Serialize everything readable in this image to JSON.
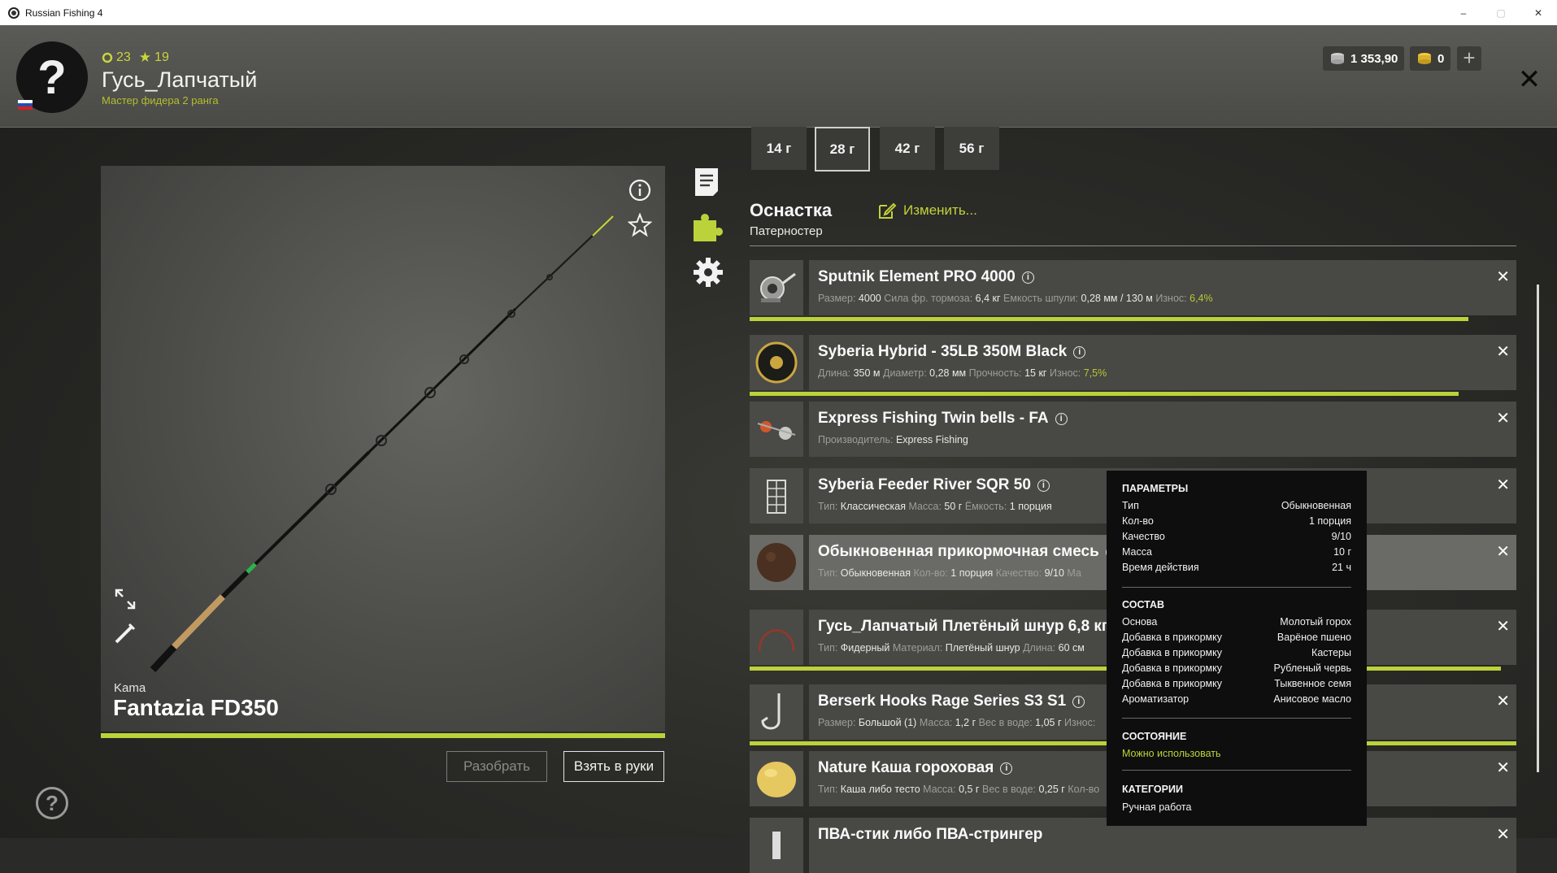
{
  "window": {
    "title": "Russian Fishing 4",
    "min": "–",
    "max": "▢",
    "close": "✕"
  },
  "player": {
    "avatar_glyph": "?",
    "level": "23",
    "stars": "19",
    "name": "Гусь_Лапчатый",
    "rank": "Мастер фидера 2 ранга"
  },
  "currency": {
    "silver": "1 353,90",
    "gold": "0",
    "plus": "+"
  },
  "rod": {
    "brand": "Kama",
    "name": "Fantazia FD350",
    "progress": 1.0,
    "btn_disassemble": "Разобрать",
    "btn_take": "Взять в руки"
  },
  "weights": [
    "14 г",
    "28 г",
    "42 г",
    "56 г"
  ],
  "weights_active": "28 г",
  "tackle": {
    "title": "Оснастка",
    "subtitle": "Патерностер",
    "change": "Изменить..."
  },
  "items": [
    {
      "name": "Sputnik Element PRO 4000",
      "info": true,
      "details": [
        [
          "Размер:",
          "4000"
        ],
        [
          "Сила фр. тормоза:",
          "6,4 кг"
        ],
        [
          "Емкость шпули:",
          "0,28 мм / 130 м"
        ],
        [
          "Износ:",
          "6,4%"
        ]
      ],
      "durability": 0.937
    },
    {
      "name": "Syberia Hybrid - 35LB 350M Black",
      "info": true,
      "details": [
        [
          "Длина:",
          "350 м"
        ],
        [
          "Диаметр:",
          "0,28 мм"
        ],
        [
          "Прочность:",
          "15 кг"
        ],
        [
          "Износ:",
          "7,5%"
        ]
      ],
      "durability": 0.925
    },
    {
      "name": "Express Fishing Twin bells - FA",
      "info": true,
      "details": [
        [
          "Производитель:",
          "Express Fishing"
        ]
      ]
    },
    {
      "name": "Syberia Feeder River SQR 50",
      "info": true,
      "details": [
        [
          "Тип:",
          "Классическая"
        ],
        [
          "Масса:",
          "50 г"
        ],
        [
          "Ёмкость:",
          "1 порция"
        ]
      ]
    },
    {
      "name": "Обыкновенная прикормочная смесь",
      "info": true,
      "details": [
        [
          "Тип:",
          "Обыкновенная"
        ],
        [
          "Кол-во:",
          "1 порция"
        ],
        [
          "Качество:",
          "9/10"
        ],
        [
          "Ма",
          ""
        ]
      ]
    },
    {
      "name": "Гусь_Лапчатый Плетёный шнур 6,8 кг",
      "info": true,
      "details": [
        [
          "Тип:",
          "Фидерный"
        ],
        [
          "Материал:",
          "Плетёный шнур"
        ],
        [
          "Длина:",
          "60 см"
        ]
      ],
      "durability": 0.98
    },
    {
      "name": "Berserk Hooks Rage Series S3 S1",
      "info": true,
      "details": [
        [
          "Размер:",
          "Большой (1)"
        ],
        [
          "Масса:",
          "1,2 г"
        ],
        [
          "Вес в воде:",
          "1,05 г"
        ],
        [
          "Износ:",
          ""
        ]
      ],
      "durability": 1.0
    },
    {
      "name": "Nature Каша гороховая",
      "info": true,
      "details": [
        [
          "Тип:",
          "Каша либо тесто"
        ],
        [
          "Масса:",
          "0,5 г"
        ],
        [
          "Вес в воде:",
          "0,25 г"
        ],
        [
          "Кол-во",
          ""
        ]
      ]
    },
    {
      "name": "ПВА-стик либо ПВА-стрингер",
      "info": false,
      "details": []
    }
  ],
  "tooltip": {
    "params_title": "ПАРАМЕТРЫ",
    "params": [
      [
        "Тип",
        "Обыкновенная"
      ],
      [
        "Кол-во",
        "1 порция"
      ],
      [
        "Качество",
        "9/10"
      ],
      [
        "Масса",
        "10 г"
      ],
      [
        "Время действия",
        "21 ч"
      ]
    ],
    "composition_title": "СОСТАВ",
    "composition": [
      [
        "Основа",
        "Молотый горох"
      ],
      [
        "Добавка в прикормку",
        "Варёное пшено"
      ],
      [
        "Добавка в прикормку",
        "Кастеры"
      ],
      [
        "Добавка в прикормку",
        "Рубленый червь"
      ],
      [
        "Добавка в прикормку",
        "Тыквенное семя"
      ],
      [
        "Ароматизатор",
        "Анисовое масло"
      ]
    ],
    "state_title": "СОСТОЯНИЕ",
    "state": "Можно использовать",
    "categories_title": "КАТЕГОРИИ",
    "categories": "Ручная работа"
  },
  "colors": {
    "accent": "#bcd23a",
    "link": "#c2d13a",
    "wear": "#b8c834"
  }
}
